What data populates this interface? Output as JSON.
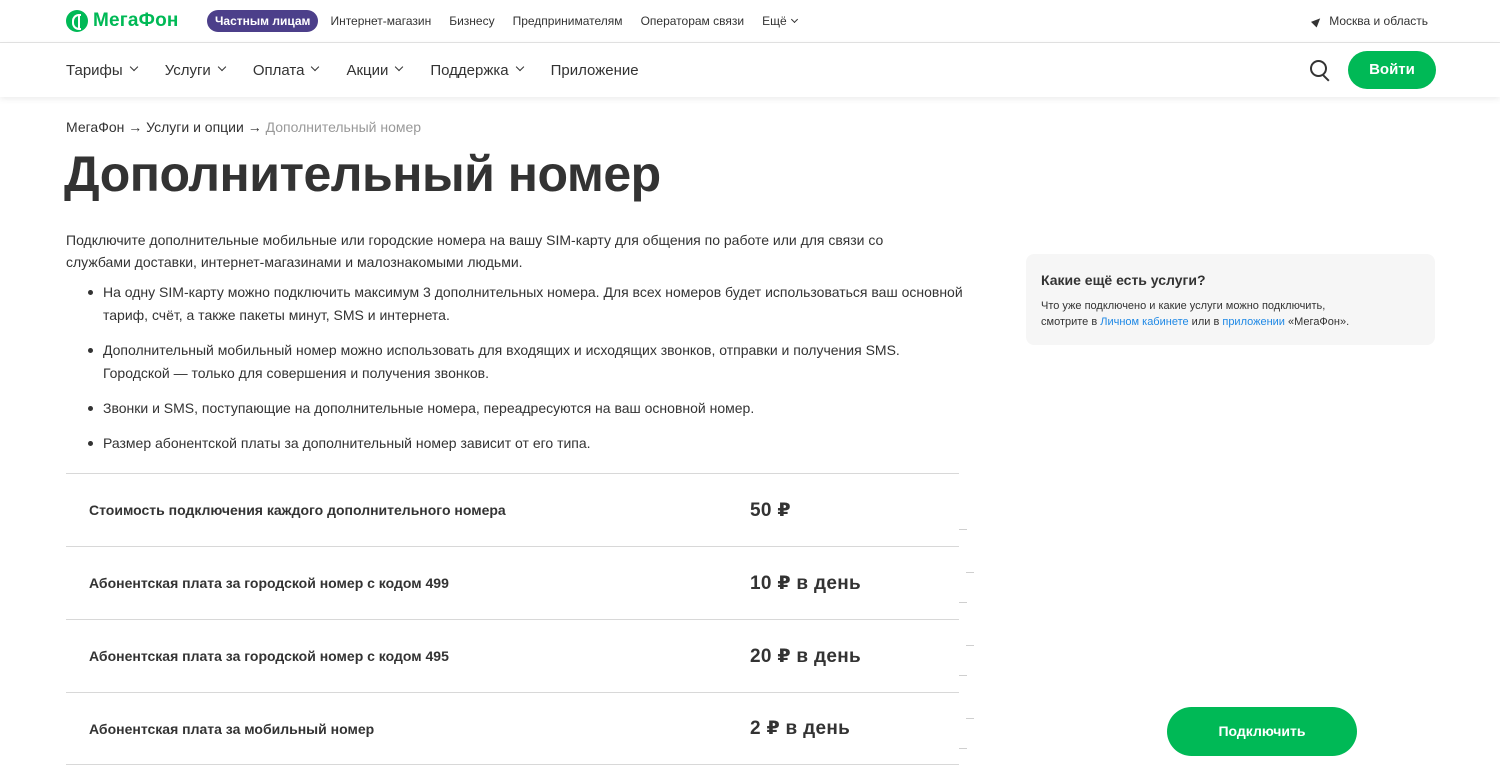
{
  "topbar": {
    "logo": "МегаФон",
    "nav": [
      "Частным лицам",
      "Интернет-магазин",
      "Бизнесу",
      "Предпринимателям",
      "Операторам связи",
      "Ещё"
    ],
    "region": "Москва и область"
  },
  "mainnav": {
    "items": [
      "Тарифы",
      "Услуги",
      "Оплата",
      "Акции",
      "Поддержка",
      "Приложение"
    ],
    "login": "Войти"
  },
  "breadcrumb": {
    "home": "МегаФон",
    "sep": " → ",
    "section": "Услуги и опции",
    "current": "Дополнительный номер"
  },
  "page": {
    "title": "Дополнительный номер",
    "intro": "Подключите дополнительные мобильные или городские номера на вашу SIM-карту для общения по работе или для связи со службами доставки, интернет-магазинами и малознакомыми людьми.",
    "bullets": [
      "На одну SIM-карту можно подключить максимум 3 дополнительных номера. Для всех номеров будет использоваться ваш основной тариф, счёт, а также пакеты минут, SMS и интернета.",
      "Дополнительный мобильный номер можно использовать для входящих и исходящих звонков, отправки и получения SMS. Городской — только для совершения и получения звонков.",
      "Звонки и SMS, поступающие на дополнительные номера, переадресуются на ваш основной номер.",
      "Размер абонентской платы за дополнительный номер зависит от его типа."
    ]
  },
  "prices": [
    {
      "label": "Стоимость подключения каждого дополнительного номера",
      "value": "50 ₽"
    },
    {
      "label": "Абонентская плата за городской номер с кодом 499",
      "value": "10 ₽ в день"
    },
    {
      "label": "Абонентская плата за городской номер с кодом 495",
      "value": "20 ₽ в день"
    },
    {
      "label": "Абонентская плата за мобильный номер",
      "value": "2 ₽ в день"
    }
  ],
  "side_card": {
    "title": "Какие ещё есть услуги?",
    "text_1": "Что уже подключено и какие услуги можно подключить,",
    "text_2": "смотрите в ",
    "link_1": "Личном кабинете",
    "text_3": " или в ",
    "link_2": "приложении",
    "text_4": " «МегаФон»."
  },
  "connect_button": "Подключить",
  "colors": {
    "brand": "#00b956",
    "pill": "#4c3f8a",
    "link": "#1e88e5"
  }
}
